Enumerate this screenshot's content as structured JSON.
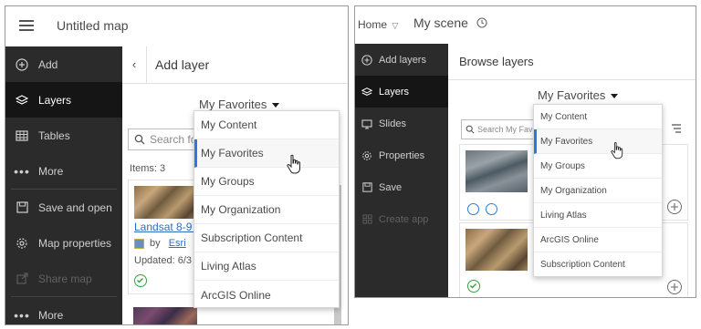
{
  "left": {
    "header": {
      "menu_icon": "hamburger-icon",
      "title": "Untitled map"
    },
    "sidebar": [
      {
        "icon": "plus-circle-icon",
        "label": "Add",
        "state": "normal"
      },
      {
        "icon": "layers-icon",
        "label": "Layers",
        "state": "active"
      },
      {
        "icon": "table-icon",
        "label": "Tables",
        "state": "normal"
      },
      {
        "icon": "more-dots-icon",
        "label": "More",
        "state": "normal"
      },
      {
        "icon": "save-icon",
        "label": "Save and open",
        "state": "normal"
      },
      {
        "icon": "gear-icon",
        "label": "Map properties",
        "state": "normal"
      },
      {
        "icon": "share-icon",
        "label": "Share map",
        "state": "disabled"
      },
      {
        "icon": "more-dots-icon",
        "label": "More",
        "state": "normal"
      }
    ],
    "panel": {
      "back_icon": "chevron-left-icon",
      "title": "Add layer",
      "dropdown_label": "My Favorites",
      "search_placeholder": "Search fo",
      "items_count": "Items: 3",
      "card": {
        "title": "Landsat 8-9 C",
        "by": "by",
        "owner": "Esri",
        "updated": "Updated: 6/3"
      }
    },
    "menu": {
      "items": [
        "My Content",
        "My Favorites",
        "My Groups",
        "My Organization",
        "Subscription Content",
        "Living Atlas",
        "ArcGIS Online"
      ],
      "selected": "My Favorites"
    }
  },
  "right": {
    "header": {
      "home": "Home",
      "title": "My scene"
    },
    "sidebar": [
      {
        "icon": "plus-circle-icon",
        "label": "Add layers",
        "state": "normal"
      },
      {
        "icon": "layers-icon",
        "label": "Layers",
        "state": "active"
      },
      {
        "icon": "slides-icon",
        "label": "Slides",
        "state": "normal"
      },
      {
        "icon": "gear-icon",
        "label": "Properties",
        "state": "normal"
      },
      {
        "icon": "save-icon",
        "label": "Save",
        "state": "normal"
      },
      {
        "icon": "create-app-icon",
        "label": "Create app",
        "state": "disabled"
      }
    ],
    "panel": {
      "title": "Browse layers",
      "dropdown_label": "My Favorites",
      "search_placeholder": "Search My Favo"
    },
    "menu": {
      "items": [
        "My Content",
        "My Favorites",
        "My Groups",
        "My Organization",
        "Living Atlas",
        "ArcGIS Online",
        "Subscription Content"
      ],
      "selected": "My Favorites"
    }
  }
}
